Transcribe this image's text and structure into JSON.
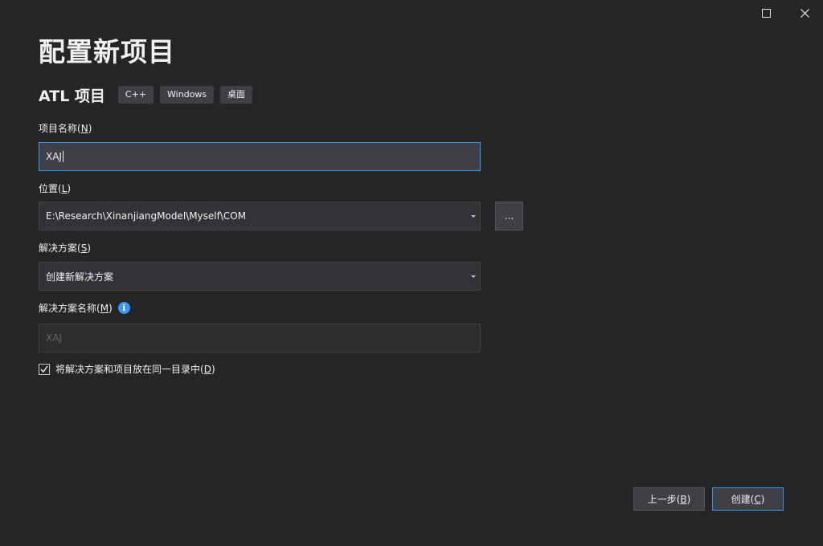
{
  "window": {
    "maximize_icon": "maximize-icon",
    "close_icon": "close-icon"
  },
  "page": {
    "title": "配置新项目"
  },
  "template": {
    "name": "ATL 项目",
    "tags": [
      "C++",
      "Windows",
      "桌面"
    ]
  },
  "project_name": {
    "label": "项目名称",
    "accesskey": "N",
    "value": "XAJ"
  },
  "location": {
    "label": "位置",
    "accesskey": "L",
    "value": "E:\\Research\\XinanjiangModel\\Myself\\COM",
    "browse_label": "..."
  },
  "solution": {
    "label": "解决方案",
    "accesskey": "S",
    "value": "创建新解决方案"
  },
  "solution_name": {
    "label": "解决方案名称",
    "accesskey": "M",
    "info_icon": "info-icon",
    "value": "XAJ"
  },
  "same_directory": {
    "label": "将解决方案和项目放在同一目录中",
    "accesskey": "D",
    "checked": true
  },
  "buttons": {
    "back_label": "上一步",
    "back_accesskey": "B",
    "create_label": "创建",
    "create_accesskey": "C"
  },
  "colors": {
    "background": "#252526",
    "accent": "#3399ff",
    "field": "#333337"
  }
}
